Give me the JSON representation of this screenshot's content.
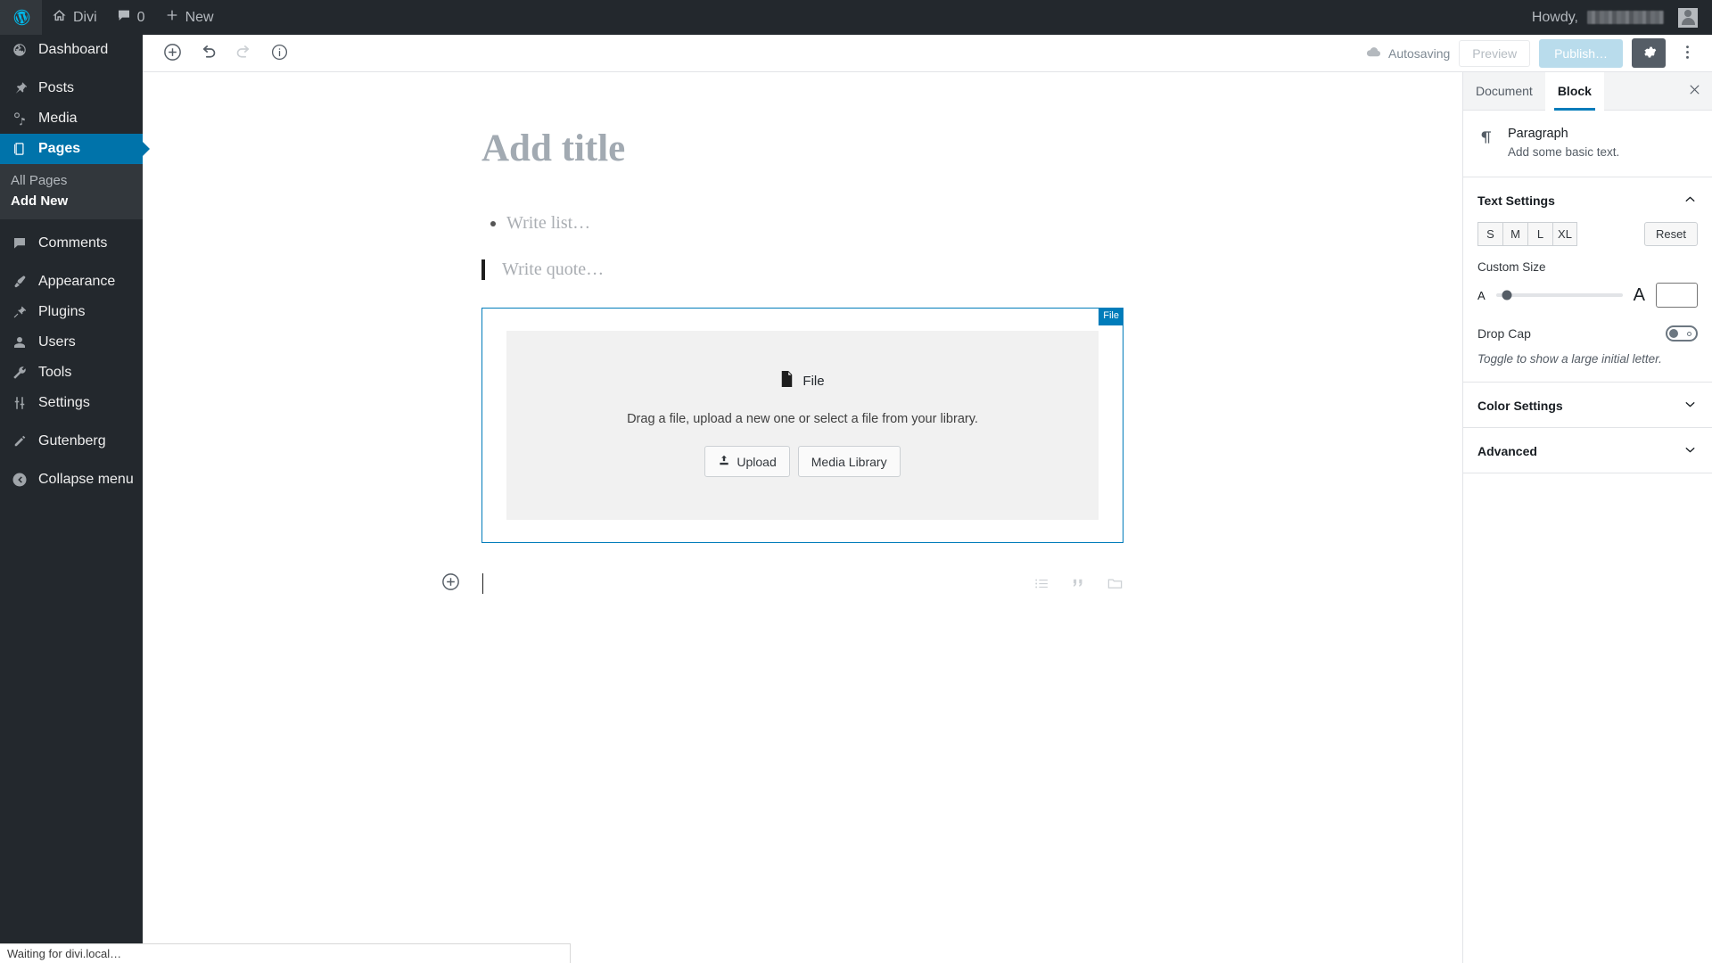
{
  "adminbar": {
    "logo_icon": "wordpress-logo-icon",
    "site_name": "Divi",
    "site_icon": "home-icon",
    "comments_icon": "comment-bubble-icon",
    "comments_count": "0",
    "new_icon": "plus-icon",
    "new_label": "New",
    "howdy_label": "Howdy,",
    "username_redacted": true,
    "avatar_icon": "user-avatar-icon"
  },
  "sidebar": {
    "items": [
      {
        "label": "Dashboard",
        "icon": "dashboard-icon",
        "current": false
      },
      {
        "label": "Posts",
        "icon": "pin-icon",
        "current": false
      },
      {
        "label": "Media",
        "icon": "media-icon",
        "current": false
      },
      {
        "label": "Pages",
        "icon": "pages-icon",
        "current": true
      },
      {
        "label": "Comments",
        "icon": "comment-bubble-icon",
        "current": false
      },
      {
        "label": "Appearance",
        "icon": "paintbrush-icon",
        "current": false
      },
      {
        "label": "Plugins",
        "icon": "plug-icon",
        "current": false
      },
      {
        "label": "Users",
        "icon": "user-icon",
        "current": false
      },
      {
        "label": "Tools",
        "icon": "wrench-icon",
        "current": false
      },
      {
        "label": "Settings",
        "icon": "sliders-icon",
        "current": false
      },
      {
        "label": "Gutenberg",
        "icon": "pencil-icon",
        "current": false
      }
    ],
    "submenu": [
      {
        "label": "All Pages",
        "current": false
      },
      {
        "label": "Add New",
        "current": true
      }
    ],
    "collapse": {
      "label": "Collapse menu",
      "icon": "collapse-arrow-icon"
    }
  },
  "editor_header": {
    "add_block_icon": "plus-circle-icon",
    "undo_icon": "undo-arrow-icon",
    "redo_icon": "redo-arrow-icon",
    "info_icon": "info-circle-icon",
    "autosave_icon": "cloud-icon",
    "autosave_label": "Autosaving",
    "preview_label": "Preview",
    "publish_label": "Publish…",
    "settings_icon": "gear-icon",
    "more_icon": "ellipsis-vertical-icon"
  },
  "editor": {
    "title_placeholder": "Add title",
    "list_placeholder": "Write list…",
    "quote_placeholder": "Write quote…",
    "file_block": {
      "badge": "File",
      "icon": "file-document-icon",
      "heading": "File",
      "description": "Drag a file, upload a new one or select a file from your library.",
      "upload_label": "Upload",
      "upload_icon": "upload-icon",
      "media_library_label": "Media Library"
    },
    "empty_block": {
      "inserter_icon": "plus-circle-icon",
      "quick_icons": [
        "list-icon",
        "quote-icon",
        "file-folder-icon"
      ]
    }
  },
  "settings_panel": {
    "tabs": [
      {
        "label": "Document",
        "active": false
      },
      {
        "label": "Block",
        "active": true
      }
    ],
    "close_icon": "close-x-icon",
    "block_card": {
      "icon": "pilcrow-icon",
      "title": "Paragraph",
      "description": "Add some basic text."
    },
    "text_settings": {
      "title": "Text Settings",
      "collapse_icon": "chevron-up-icon",
      "sizes": [
        "S",
        "M",
        "L",
        "XL"
      ],
      "reset_label": "Reset",
      "custom_size_label": "Custom Size",
      "slider_min_glyph": "A",
      "slider_max_glyph": "A",
      "slider_value_percent": 9,
      "size_input_value": "",
      "drop_cap_label": "Drop Cap",
      "drop_cap_on": false,
      "drop_cap_help": "Toggle to show a large initial letter."
    },
    "panels": [
      {
        "title": "Color Settings",
        "expand_icon": "chevron-down-icon"
      },
      {
        "title": "Advanced",
        "expand_icon": "chevron-down-icon"
      }
    ]
  },
  "statusbar": {
    "text": "Waiting for divi.local…"
  },
  "colors": {
    "admin_dark": "#23282d",
    "admin_submenu": "#32373c",
    "accent_blue": "#0073aa",
    "gutenberg_blue": "#007cba",
    "publish_disabled": "#b9dcec"
  }
}
